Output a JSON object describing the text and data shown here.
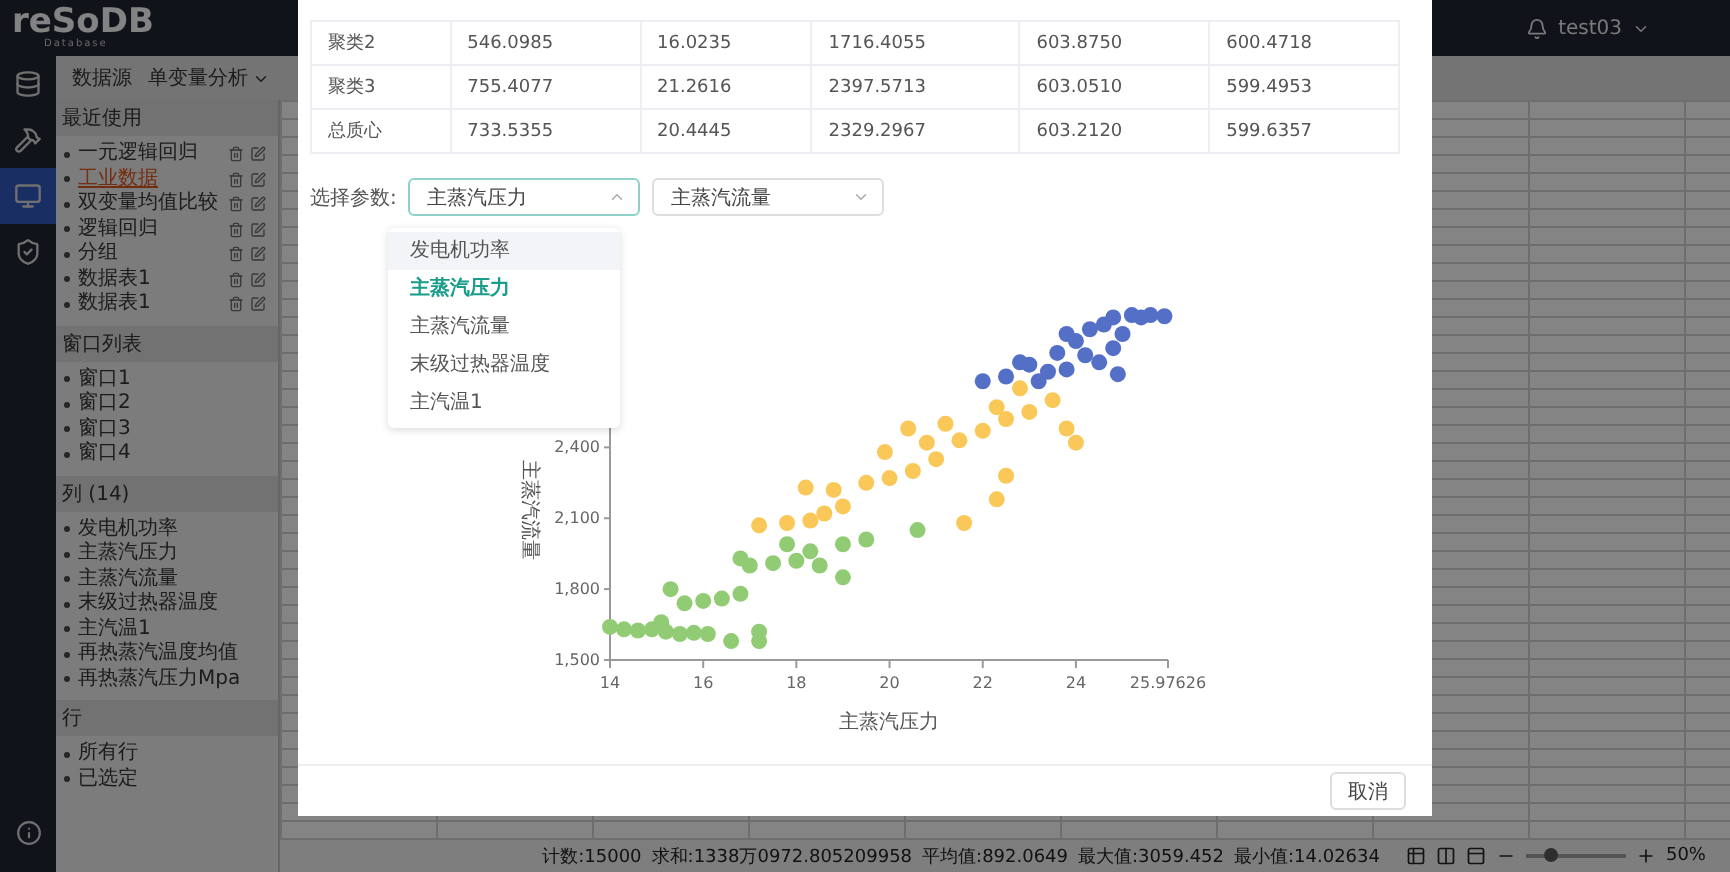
{
  "header": {
    "logo": "reSoDB",
    "logo_sub": "Database",
    "user": "test03"
  },
  "rail": [
    {
      "kind": "database",
      "selected": false
    },
    {
      "kind": "tools",
      "selected": false
    },
    {
      "kind": "monitor",
      "selected": true
    },
    {
      "kind": "shield",
      "selected": false
    }
  ],
  "toolbar": [
    "数据源",
    "单变量分析"
  ],
  "sections": [
    {
      "title": "最近使用",
      "kind": "actions",
      "items": [
        {
          "label": "一元逻辑回归",
          "selected": false
        },
        {
          "label": "工业数据",
          "selected": true
        },
        {
          "label": "双变量均值比较",
          "selected": false
        },
        {
          "label": "逻辑回归",
          "selected": false
        },
        {
          "label": "分组",
          "selected": false
        },
        {
          "label": "数据表1",
          "selected": false
        },
        {
          "label": "数据表1",
          "selected": false
        }
      ]
    },
    {
      "title": "窗口列表",
      "kind": "plain",
      "items": [
        {
          "label": "窗口1"
        },
        {
          "label": "窗口2"
        },
        {
          "label": "窗口3"
        },
        {
          "label": "窗口4"
        }
      ]
    },
    {
      "title": "列 (14)",
      "kind": "plain",
      "items": [
        {
          "label": "发电机功率"
        },
        {
          "label": "主蒸汽压力"
        },
        {
          "label": "主蒸汽流量"
        },
        {
          "label": "末级过热器温度"
        },
        {
          "label": "主汽温1"
        },
        {
          "label": "再热蒸汽温度均值"
        },
        {
          "label": "再热蒸汽压力Mpa"
        }
      ]
    },
    {
      "title": "行",
      "kind": "plain",
      "items": [
        {
          "label": "所有行"
        },
        {
          "label": "已选定"
        }
      ]
    }
  ],
  "status_bar": {
    "stats": [
      "计数:15000",
      "求和:1338万0972.805209958",
      "平均值:892.0649",
      "最大值:3059.452",
      "最小值:14.02634"
    ],
    "zoom": "50%",
    "level": 0.25
  },
  "modal": {
    "table": {
      "rows": [
        [
          "聚类2",
          "546.0985",
          "16.0235",
          "1716.4055",
          "603.8750",
          "600.4718"
        ],
        [
          "聚类3",
          "755.4077",
          "21.2616",
          "2397.5713",
          "603.0510",
          "599.4953"
        ],
        [
          "总质心",
          "733.5355",
          "20.4445",
          "2329.2967",
          "603.2120",
          "599.6357"
        ]
      ]
    },
    "param_label": "选择参数:",
    "selects": [
      {
        "value": "主蒸汽压力",
        "expanded": true
      },
      {
        "value": "主蒸汽流量",
        "expanded": false
      }
    ],
    "dropdown": [
      {
        "label": "发电机功率",
        "selected": false,
        "hovered": true
      },
      {
        "label": "主蒸汽压力",
        "selected": true,
        "hovered": false
      },
      {
        "label": "主蒸汽流量",
        "selected": false,
        "hovered": false
      },
      {
        "label": "末级过热器温度",
        "selected": false,
        "hovered": false
      },
      {
        "label": "主汽温1",
        "selected": false,
        "hovered": false
      }
    ],
    "chart_data": {
      "type": "scatter",
      "xlabel": "主蒸汽压力",
      "ylabel": "主蒸汽流量",
      "xlim": [
        14,
        25.97626
      ],
      "ylim": [
        1500,
        3100
      ],
      "xticks": [
        14,
        16,
        18,
        20,
        22,
        24,
        {
          "value": 25.97626,
          "label": "25.97626"
        }
      ],
      "yticks": [
        {
          "value": 1500,
          "label": "1,500"
        },
        {
          "value": 1800,
          "label": "1,800"
        },
        {
          "value": 2100,
          "label": "2,100"
        },
        {
          "value": 2400,
          "label": "2,400"
        }
      ],
      "series": [
        {
          "color": "#5470c6",
          "x": [
            22,
            22.5,
            23,
            23.2,
            23.6,
            24,
            24.3,
            24.8,
            25.2,
            25.6,
            25.9,
            23.8,
            24.5,
            24.8,
            25,
            23.4,
            24.2,
            22.8,
            24.6,
            25.4,
            24.9,
            23.8
          ],
          "values": [
            2680,
            2700,
            2750,
            2680,
            2800,
            2850,
            2900,
            2950,
            2960,
            2960,
            2955,
            2730,
            2760,
            2820,
            2880,
            2720,
            2790,
            2760,
            2920,
            2950,
            2710,
            2880
          ]
        },
        {
          "color": "#fac858",
          "x": [
            17.2,
            17.8,
            18.3,
            18.6,
            19,
            18.8,
            19.5,
            20,
            20.5,
            19.9,
            20.8,
            21.5,
            22,
            21.2,
            22.5,
            23,
            22.3,
            23.5,
            22.8,
            18.2,
            21.6,
            22.3,
            22.5,
            23.8,
            24,
            20.4,
            21
          ],
          "values": [
            2070,
            2080,
            2090,
            2120,
            2150,
            2220,
            2250,
            2270,
            2300,
            2380,
            2420,
            2430,
            2470,
            2500,
            2520,
            2550,
            2570,
            2600,
            2650,
            2230,
            2080,
            2180,
            2280,
            2480,
            2420,
            2480,
            2350
          ]
        },
        {
          "color": "#91cc75",
          "x": [
            14,
            14.3,
            14.6,
            14.9,
            15.2,
            15.5,
            15.8,
            16.1,
            15.1,
            15.6,
            16,
            16.4,
            16.8,
            15.3,
            17,
            17.5,
            18,
            18.5,
            18.3,
            17.8,
            19,
            19.5,
            16.8,
            17.2,
            17.2,
            20.6,
            19,
            16.6
          ],
          "values": [
            1640,
            1630,
            1625,
            1630,
            1620,
            1610,
            1615,
            1610,
            1660,
            1740,
            1750,
            1760,
            1780,
            1800,
            1900,
            1910,
            1920,
            1900,
            1960,
            1990,
            1990,
            2010,
            1930,
            1580,
            1620,
            2050,
            1850,
            1580
          ]
        }
      ]
    },
    "cancel": "取消"
  }
}
